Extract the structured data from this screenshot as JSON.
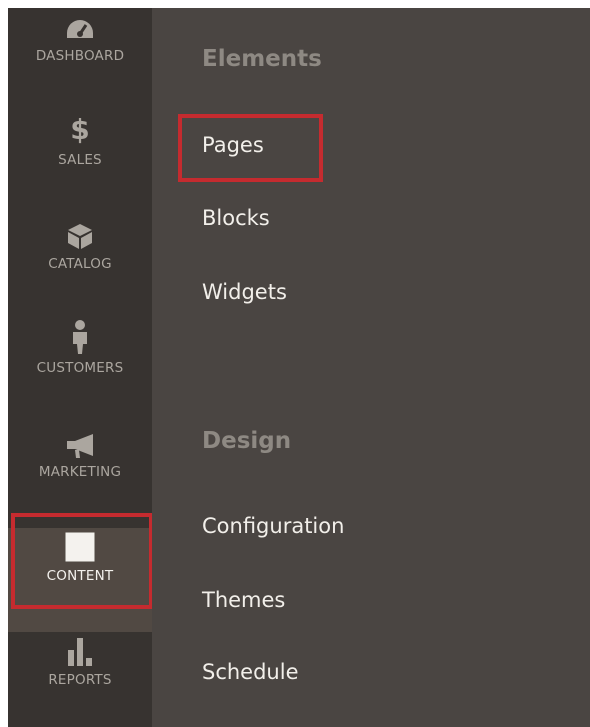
{
  "sidebar": {
    "items": [
      {
        "label": "DASHBOARD",
        "icon": "dashboard-gauge-icon"
      },
      {
        "label": "SALES",
        "icon": "dollar-icon"
      },
      {
        "label": "CATALOG",
        "icon": "box-icon"
      },
      {
        "label": "CUSTOMERS",
        "icon": "person-icon"
      },
      {
        "label": "MARKETING",
        "icon": "megaphone-icon"
      },
      {
        "label": "CONTENT",
        "icon": "layout-icon",
        "active": true
      },
      {
        "label": "REPORTS",
        "icon": "bar-chart-icon"
      }
    ]
  },
  "panel": {
    "sections": [
      {
        "title": "Elements",
        "links": [
          "Pages",
          "Blocks",
          "Widgets"
        ]
      },
      {
        "title": "Design",
        "links": [
          "Configuration",
          "Themes",
          "Schedule"
        ]
      }
    ]
  },
  "colors": {
    "sidebar_bg": "#373330",
    "panel_bg": "#4a4542",
    "highlight": "#c52b2f",
    "section_title": "#8e8983",
    "link_text": "#f2efea"
  }
}
